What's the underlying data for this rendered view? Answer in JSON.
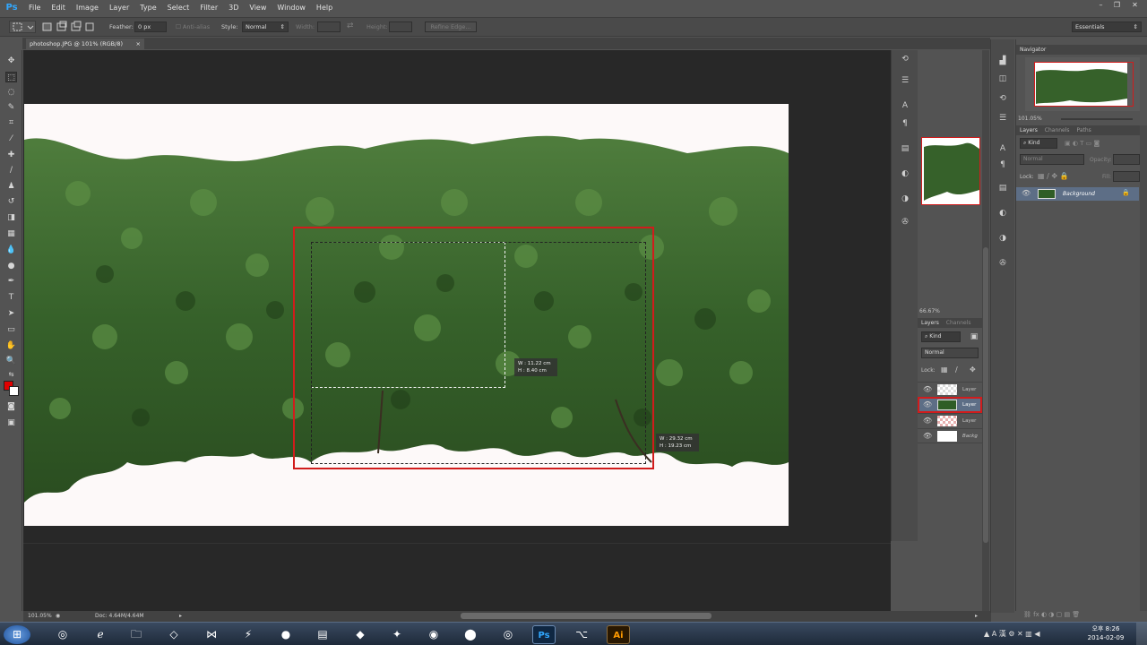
{
  "app": {
    "logo": "Ps",
    "tab_title": "photoshop.JPG @ 101% (RGB/8)",
    "tab_close": "×"
  },
  "menu": [
    "File",
    "Edit",
    "Image",
    "Layer",
    "Type",
    "Select",
    "Filter",
    "3D",
    "View",
    "Window",
    "Help"
  ],
  "window_controls": {
    "minimize": "–",
    "restore": "❐",
    "close": "✕"
  },
  "options": {
    "feather_label": "Feather:",
    "feather_value": "0 px",
    "antialias_label": "Anti-alias",
    "style_label": "Style:",
    "style_value": "Normal",
    "width_label": "Width:",
    "height_label": "Height:",
    "refine_label": "Refine Edge...",
    "workspace": "Essentials"
  },
  "selection": {
    "inner_w": "W :  11.22 cm",
    "inner_h": "H :    8.40 cm",
    "outer_w": "W :  29.32 cm",
    "outer_h": "H :  19.23 cm"
  },
  "status": {
    "zoom": "101.05%",
    "doc": "Doc: 4.64M/4.64M"
  },
  "floating_panel": {
    "zoom": "66.67%",
    "tabs": [
      "Layers",
      "Channels"
    ],
    "kind": "Kind",
    "blend": "Normal",
    "lock": "Lock:",
    "layers": [
      "Layer",
      "Layer",
      "Layer",
      "Backg"
    ]
  },
  "navigator": {
    "title": "Navigator",
    "zoom": "101.05%"
  },
  "layers_panel": {
    "tabs": [
      "Layers",
      "Channels",
      "Paths"
    ],
    "kind": "Kind",
    "blend": "Normal",
    "opacity_label": "Opacity:",
    "lock_label": "Lock:",
    "fill_label": "Fill:",
    "background_layer": "Background"
  },
  "taskbar": {
    "time": "오후 8:26",
    "date": "2014-02-09",
    "active_app": "Ps",
    "ai_label": "Ai"
  },
  "colors": {
    "selection": "#d11c1c",
    "foreground": "#e00000",
    "background": "#ffffff",
    "ps_blue": "#31a8ff"
  }
}
